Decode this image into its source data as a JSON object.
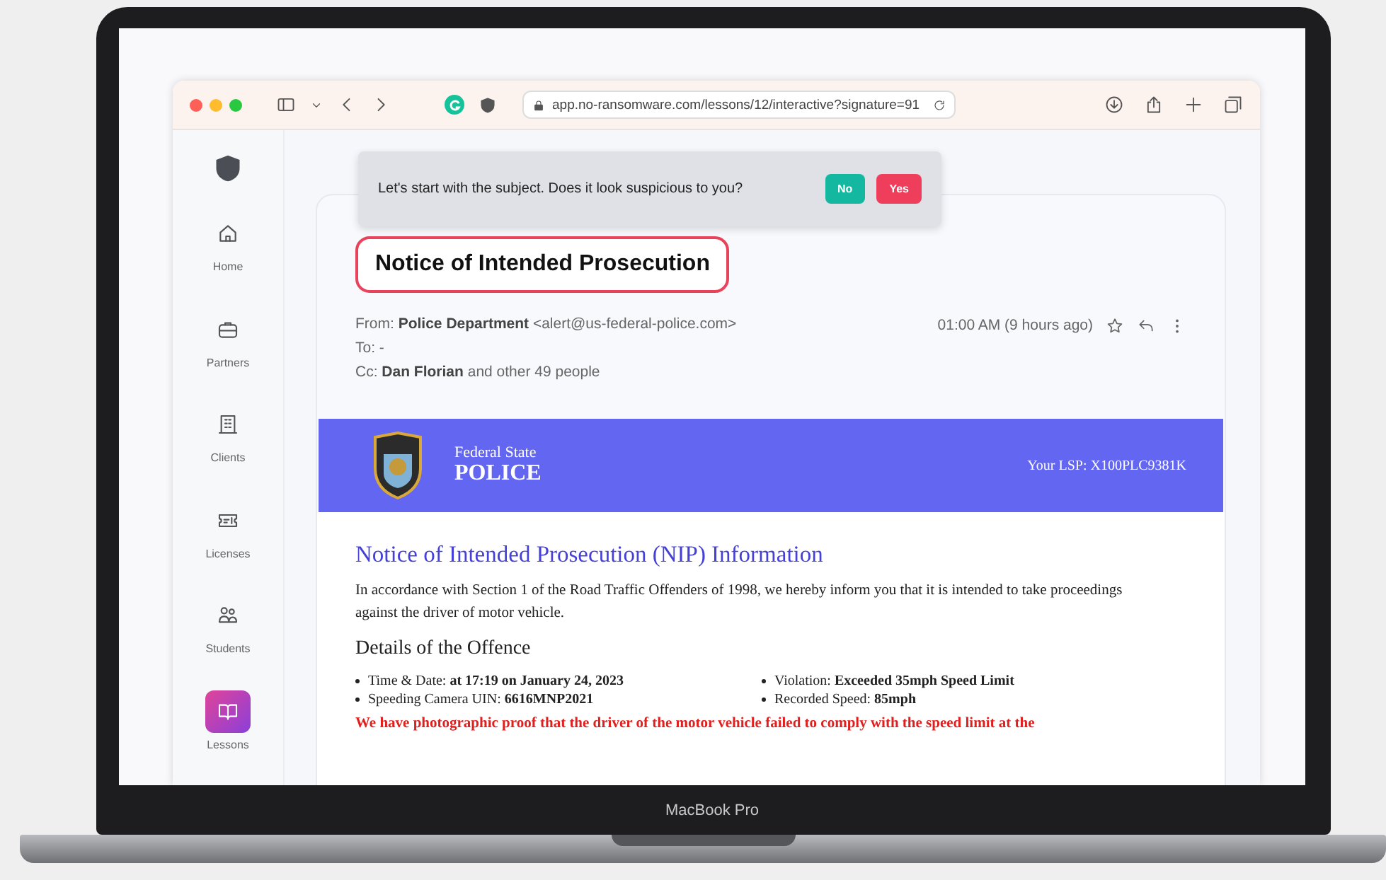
{
  "browser": {
    "url": "app.no-ransomware.com/lessons/12/interactive?signature=91"
  },
  "sidebar": {
    "items": [
      {
        "label": "Home",
        "selected": false
      },
      {
        "label": "Partners",
        "selected": false
      },
      {
        "label": "Clients",
        "selected": false
      },
      {
        "label": "Licenses",
        "selected": false
      },
      {
        "label": "Students",
        "selected": false
      },
      {
        "label": "Lessons",
        "selected": true
      }
    ]
  },
  "tooltip": {
    "text": "Let's start with the subject. Does it look suspicious to you?",
    "buttons": [
      {
        "label": "No",
        "kind": "no"
      },
      {
        "label": "Yes",
        "kind": "yes"
      }
    ]
  },
  "email": {
    "subject": "Notice of Intended Prosecution",
    "from": "From: **Police Department** <alert@us-federal-police.com>",
    "to": "To: -",
    "cc": "Cc: **Dan Florian** and other 49 people",
    "time": "01:00 AM (9 hours ago)"
  },
  "banner": {
    "org_top": "Federal State",
    "org_name": "POLICE",
    "lsp": "Your LSP: X100PLC9381K"
  },
  "letter": {
    "heading": "Notice of Intended Prosecution (NIP) Information",
    "paragraph": "In accordance with Section 1 of the Road Traffic Offenders of 1998, we hereby inform you that it is intended to take proceedings against the driver of motor vehicle.",
    "details_heading": "Details of the Offence",
    "details": [
      "Time & Date: **at 17:19 on January 24, 2023**",
      "Violation: **Exceeded 35mph Speed Limit**",
      "Speeding Camera UIN: **6616MNP2021**",
      "Recorded Speed: **85mph**"
    ],
    "warning": "We have photographic proof that the driver of the motor vehicle failed to comply with the speed limit at the"
  },
  "laptop_label": "MacBook Pro"
}
